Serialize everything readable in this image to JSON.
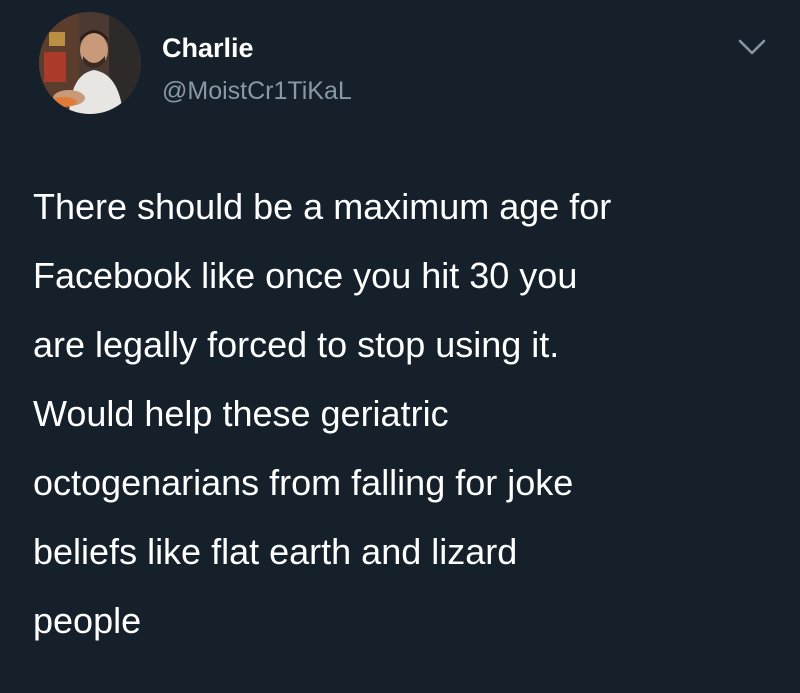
{
  "tweet": {
    "author": {
      "display_name": "Charlie",
      "handle": "@MoistCr1TiKaL",
      "avatar_icon": "profile-photo"
    },
    "menu_icon": "chevron-down-icon",
    "text_lines": [
      "There should be a maximum age for",
      "Facebook like once you hit 30 you",
      "are legally forced to stop using it.",
      "Would help these geriatric",
      "octogenarians from falling for joke",
      "beliefs like flat earth and lizard",
      "people"
    ]
  },
  "colors": {
    "background": "#15202b",
    "primary_text": "#ffffff",
    "secondary_text": "#8899a6"
  }
}
